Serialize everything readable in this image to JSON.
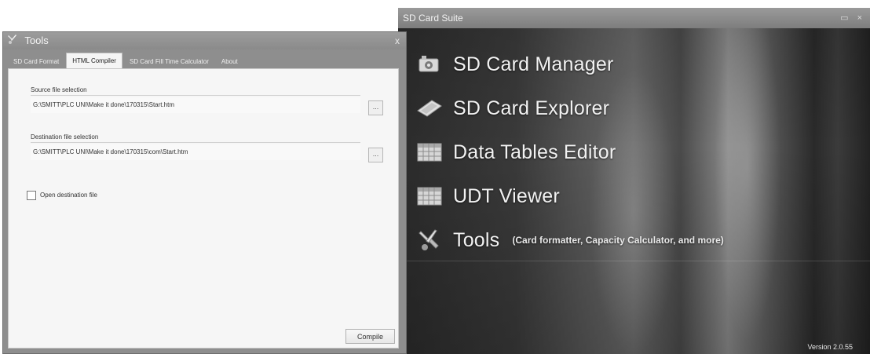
{
  "suite": {
    "title": "SD Card Suite",
    "window_buttons": [
      "▭",
      "×"
    ],
    "menu": [
      {
        "label": "SD Card Manager",
        "icon": "sd-card-manager-icon"
      },
      {
        "label": "SD Card Explorer",
        "icon": "sd-card-icon"
      },
      {
        "label": "Data Tables Editor",
        "icon": "table-grid-icon"
      },
      {
        "label": "UDT Viewer",
        "icon": "table-grid-icon"
      },
      {
        "label": "Tools",
        "sublabel": "(Card formatter, Capacity Calculator,  and more)",
        "icon": "tools-icon"
      }
    ],
    "version": "Version 2.0.55"
  },
  "tools": {
    "title": "Tools",
    "close": "x",
    "tabs": [
      "SD Card Format",
      "HTML Compiler",
      "SD Card Fill Time Calculator",
      "About"
    ],
    "active_tab": "HTML Compiler",
    "source": {
      "label": "Source file selection",
      "value": "G:\\SMITT\\PLC UNI\\Make it done\\170315\\Start.htm"
    },
    "destination": {
      "label": "Destination file selection",
      "value": "G:\\SMITT\\PLC UNI\\Make it done\\170315\\com\\Start.htm"
    },
    "browse_label": "...",
    "open_destination": {
      "label": "Open destination file",
      "checked": false
    },
    "compile_label": "Compile"
  }
}
